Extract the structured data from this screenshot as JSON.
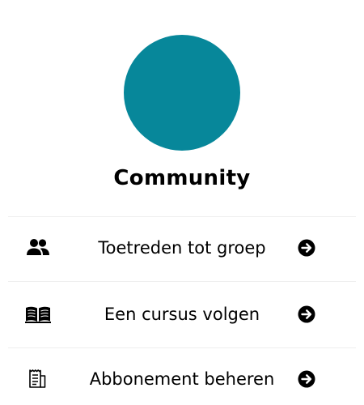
{
  "profile": {
    "avatar_color": "#07879a",
    "title": "Community"
  },
  "menu": {
    "items": [
      {
        "label": "Toetreden tot groep",
        "icon": "users-icon",
        "action_icon": "arrow-right-circle-icon"
      },
      {
        "label": "Een cursus volgen",
        "icon": "book-open-icon",
        "action_icon": "arrow-right-circle-icon"
      },
      {
        "label": "Abbonement beheren",
        "icon": "receipt-icon",
        "action_icon": "arrow-right-circle-icon"
      }
    ]
  }
}
